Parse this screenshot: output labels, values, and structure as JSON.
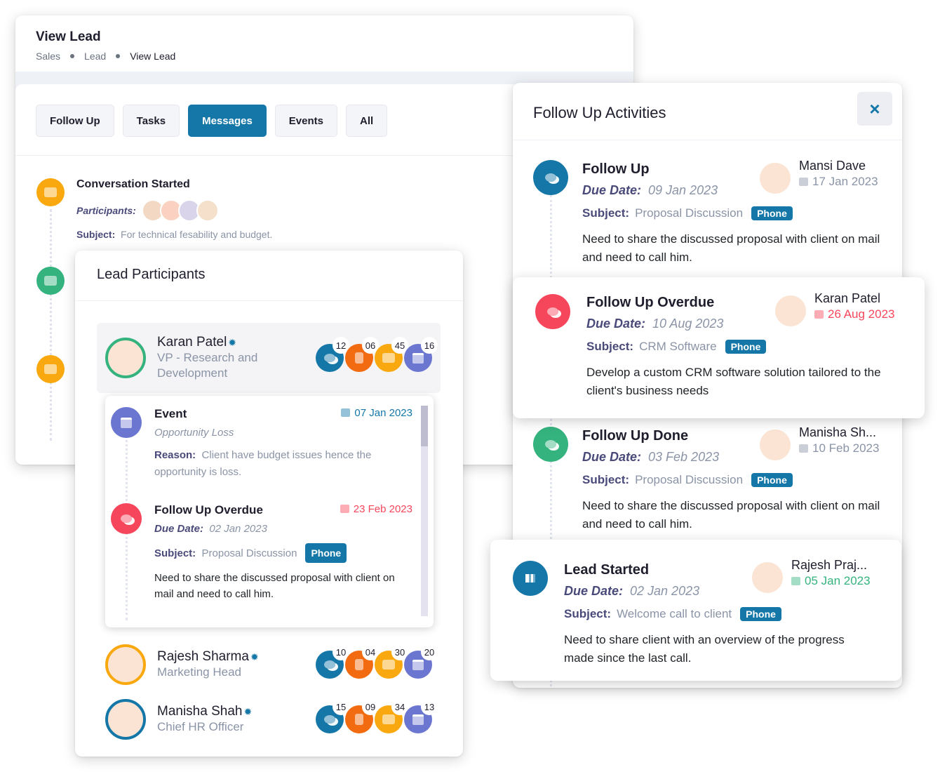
{
  "view_lead": {
    "title": "View Lead",
    "breadcrumb": [
      "Sales",
      "Lead",
      "View Lead"
    ],
    "tabs": [
      {
        "label": "Follow Up",
        "active": false
      },
      {
        "label": "Tasks",
        "active": false
      },
      {
        "label": "Messages",
        "active": true
      },
      {
        "label": "Events",
        "active": false
      },
      {
        "label": "All",
        "active": false
      }
    ],
    "conversation": {
      "title": "Conversation Started",
      "participants_label": "Participants:",
      "subject_label": "Subject:",
      "subject": "For technical fesability and budget."
    }
  },
  "lead_participants": {
    "title": "Lead Participants",
    "participants": [
      {
        "name": "Karan Patel",
        "role": "VP - Research and Development",
        "ring_color": "#35b37e",
        "counts": {
          "messages": "12",
          "tasks": "06",
          "chats": "45",
          "events": "16"
        }
      },
      {
        "name": "Rajesh Sharma",
        "role": "Marketing Head",
        "ring_color": "#f9a80f",
        "counts": {
          "messages": "10",
          "tasks": "04",
          "chats": "30",
          "events": "20"
        }
      },
      {
        "name": "Manisha Shah",
        "role": "Chief HR Officer",
        "ring_color": "#1477a8",
        "counts": {
          "messages": "15",
          "tasks": "09",
          "chats": "34",
          "events": "13"
        }
      }
    ],
    "details": [
      {
        "title": "Event",
        "date": "07 Jan 2023",
        "subtitle": "Opportunity Loss",
        "reason_label": "Reason:",
        "reason": "Client have budget issues hence the opportunity is loss."
      },
      {
        "title": "Follow Up Overdue",
        "date": "23 Feb 2023",
        "due_label": "Due Date:",
        "due": "02 Jan 2023",
        "subject_label": "Subject:",
        "subject": "Proposal Discussion",
        "badge": "Phone",
        "description": "Need to share the discussed proposal with client on mail and need to call him."
      }
    ]
  },
  "follow_up_activities": {
    "title": "Follow Up Activities",
    "close_label": "×",
    "items": [
      {
        "title": "Follow Up",
        "due_label": "Due Date:",
        "due": "09 Jan 2023",
        "subject_label": "Subject:",
        "subject": "Proposal Discussion",
        "badge": "Phone",
        "description": "Need to share the discussed proposal with client on mail and need to call him.",
        "person": "Mansi Dave",
        "date": "17 Jan 2023"
      },
      {
        "title": "Follow Up Overdue",
        "due_label": "Due Date:",
        "due": "10 Aug 2023",
        "subject_label": "Subject:",
        "subject": "CRM Software",
        "badge": "Phone",
        "description": "Develop a custom CRM software solution tailored to the client's business needs",
        "person": "Karan Patel",
        "date": "26 Aug 2023"
      },
      {
        "title": "Follow Up Done",
        "due_label": "Due Date:",
        "due": "03 Feb 2023",
        "subject_label": "Subject:",
        "subject": "Proposal Discussion",
        "badge": "Phone",
        "description": "Need to share the discussed proposal with client on mail and need to call him.",
        "person": "Manisha Sh...",
        "date": "10 Feb 2023"
      },
      {
        "title": "Lead Started",
        "due_label": "Due Date:",
        "due": "02 Jan 2023",
        "subject_label": "Subject:",
        "subject": "Welcome call to client",
        "badge": "Phone",
        "description": "Need to share client with an overview of the progress made since the last call.",
        "person": "Rajesh Praj...",
        "date": "05 Jan 2023"
      }
    ]
  },
  "colors": {
    "primary": "#1477a8",
    "danger": "#f6465b",
    "success": "#35b37e",
    "warning": "#f9a80f",
    "orange": "#f26b11",
    "purple": "#6b76d1"
  }
}
